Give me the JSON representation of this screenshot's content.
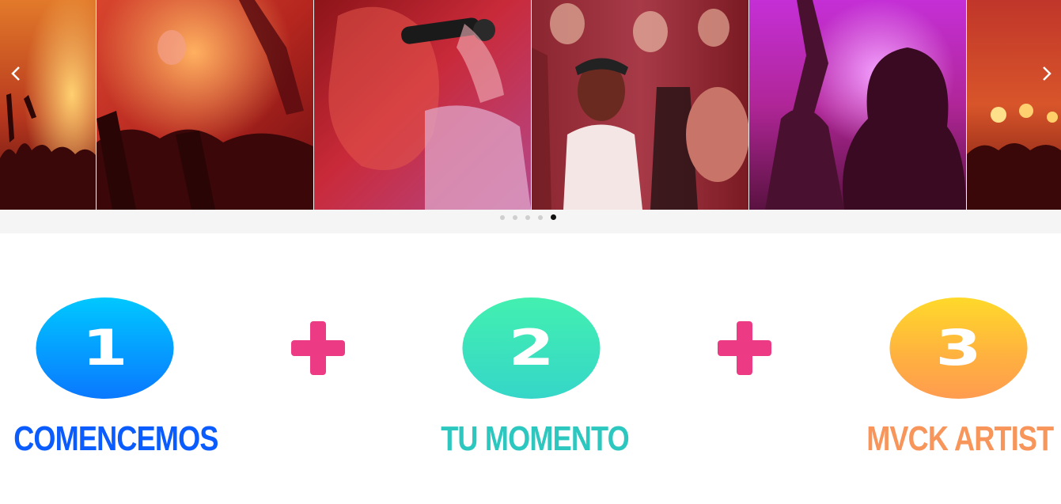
{
  "carousel": {
    "slides": [
      {
        "label": "concert-crowd-orange"
      },
      {
        "label": "concert-crowd-red"
      },
      {
        "label": "singer-microphone"
      },
      {
        "label": "cheering-fans"
      },
      {
        "label": "purple-stage-crowd"
      },
      {
        "label": "stage-lights-crowd"
      }
    ],
    "prev_icon": "chevron-left-icon",
    "next_icon": "chevron-right-icon",
    "dot_count": 5,
    "active_dot": 4
  },
  "steps": [
    {
      "number": "1",
      "title": "COMENCEMOS",
      "color": "#0a5cff"
    },
    {
      "number": "2",
      "title": "TU MOMENTO",
      "color": "#2cc8c0"
    },
    {
      "number": "3",
      "title": "MVCK ARTIST",
      "color": "#f7955a"
    }
  ],
  "plus_color": "#ec3b84"
}
